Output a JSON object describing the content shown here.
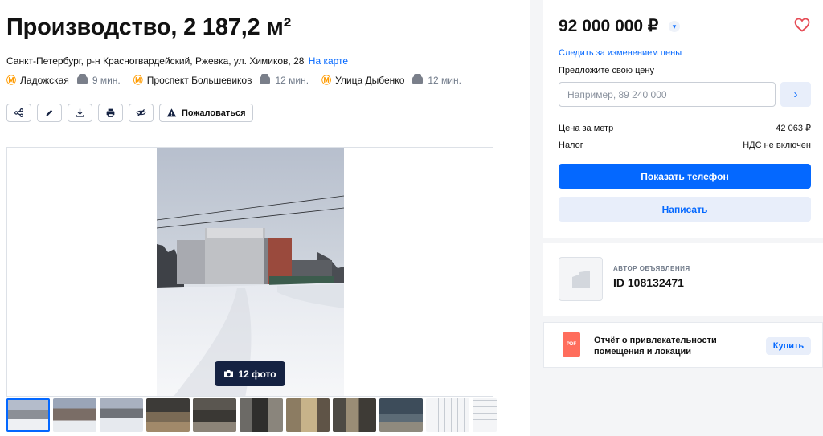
{
  "listing": {
    "title": "Производство, 2 187,2 м²",
    "address": "Санкт-Петербург, р-н Красногвардейский, Ржевка, ул. Химиков, 28",
    "map_link": "На карте",
    "metro": [
      {
        "name": "Ладожская",
        "time": "9 мин."
      },
      {
        "name": "Проспект Большевиков",
        "time": "12 мин."
      },
      {
        "name": "Улица Дыбенко",
        "time": "12 мин."
      }
    ]
  },
  "toolbar": {
    "icons": [
      "share-icon",
      "edit-icon",
      "download-icon",
      "print-icon",
      "hide-icon"
    ],
    "complain_label": "Пожаловаться"
  },
  "gallery": {
    "photo_count_label": "12 фото",
    "thumbnails": 11
  },
  "price_card": {
    "price": "92 000 000 ₽",
    "follow_link": "Следить за изменением цены",
    "offer_label": "Предложите свою цену",
    "offer_placeholder": "Например, 89 240 000",
    "rows": [
      {
        "label": "Цена за метр",
        "value": "42 063 ₽"
      },
      {
        "label": "Налог",
        "value": "НДС не включен"
      }
    ],
    "show_phone_label": "Показать телефон",
    "write_label": "Написать"
  },
  "author": {
    "label": "АВТОР ОБЪЯВЛЕНИЯ",
    "id": "ID 108132471"
  },
  "report": {
    "icon_text": "PDF",
    "text": "Отчёт о привлекательности помещения и локации",
    "buy_label": "Купить"
  },
  "colors": {
    "accent": "#0468ff",
    "accent_light": "#e8eefa",
    "metro": "#ff9b00",
    "dark": "#152242",
    "heart": "#e64b55"
  }
}
